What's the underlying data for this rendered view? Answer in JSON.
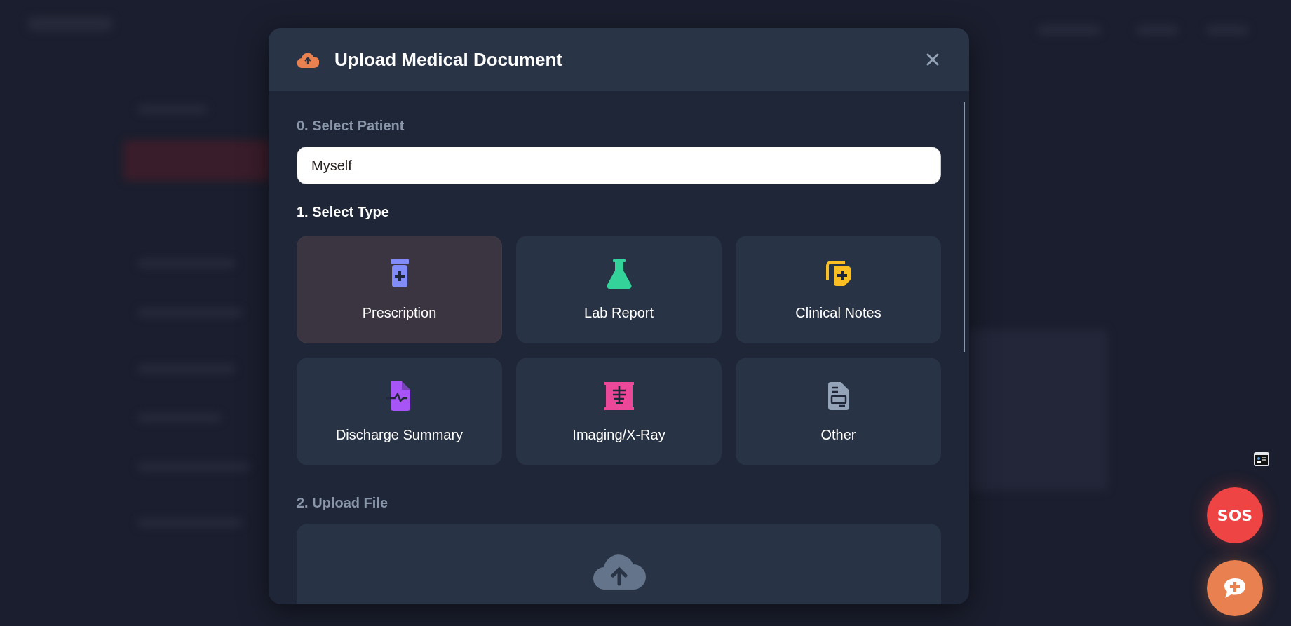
{
  "modal": {
    "title": "Upload Medical Document",
    "patient": {
      "label": "0. Select Patient",
      "value": "Myself"
    },
    "type_section": {
      "label": "1. Select Type",
      "types": [
        {
          "label": "Prescription",
          "selected": true
        },
        {
          "label": "Lab Report",
          "selected": false
        },
        {
          "label": "Clinical Notes",
          "selected": false
        },
        {
          "label": "Discharge Summary",
          "selected": false
        },
        {
          "label": "Imaging/X-Ray",
          "selected": false
        },
        {
          "label": "Other",
          "selected": false
        }
      ]
    },
    "upload_section": {
      "label": "2. Upload File"
    }
  },
  "floating": [
    {
      "kind": "card"
    },
    {
      "kind": "sos",
      "label": "SOS"
    },
    {
      "kind": "chat"
    }
  ]
}
